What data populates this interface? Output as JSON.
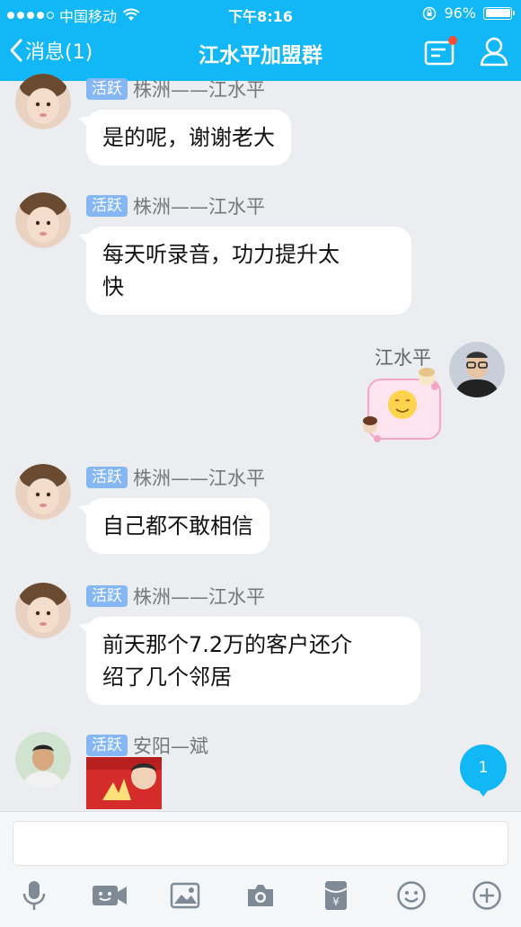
{
  "status_bar": {
    "carrier": "中国移动",
    "time": "下午8:16",
    "battery": "96%"
  },
  "nav": {
    "back_label": "消息(1)",
    "title": "江水平加盟群"
  },
  "messages": [
    {
      "tag": "活跃",
      "sender": "株洲——江水平",
      "text": "是的呢，谢谢老大"
    },
    {
      "tag": "活跃",
      "sender": "株洲——江水平",
      "text_line1": "每天听录音，功力提升太",
      "text_line2": "快"
    },
    {
      "self_name": "江水平"
    },
    {
      "tag": "活跃",
      "sender": "株洲——江水平",
      "text": "自己都不敢相信"
    },
    {
      "tag": "活跃",
      "sender": "株洲——江水平",
      "text_line1": "前天那个7.2万的客户还介",
      "text_line2": "绍了几个邻居"
    },
    {
      "tag": "活跃",
      "sender": "安阳—斌"
    }
  ],
  "unread_count": "1",
  "colors": {
    "brand": "#12b7f5",
    "tag": "#85b7f5",
    "background": "#ebedf0"
  }
}
